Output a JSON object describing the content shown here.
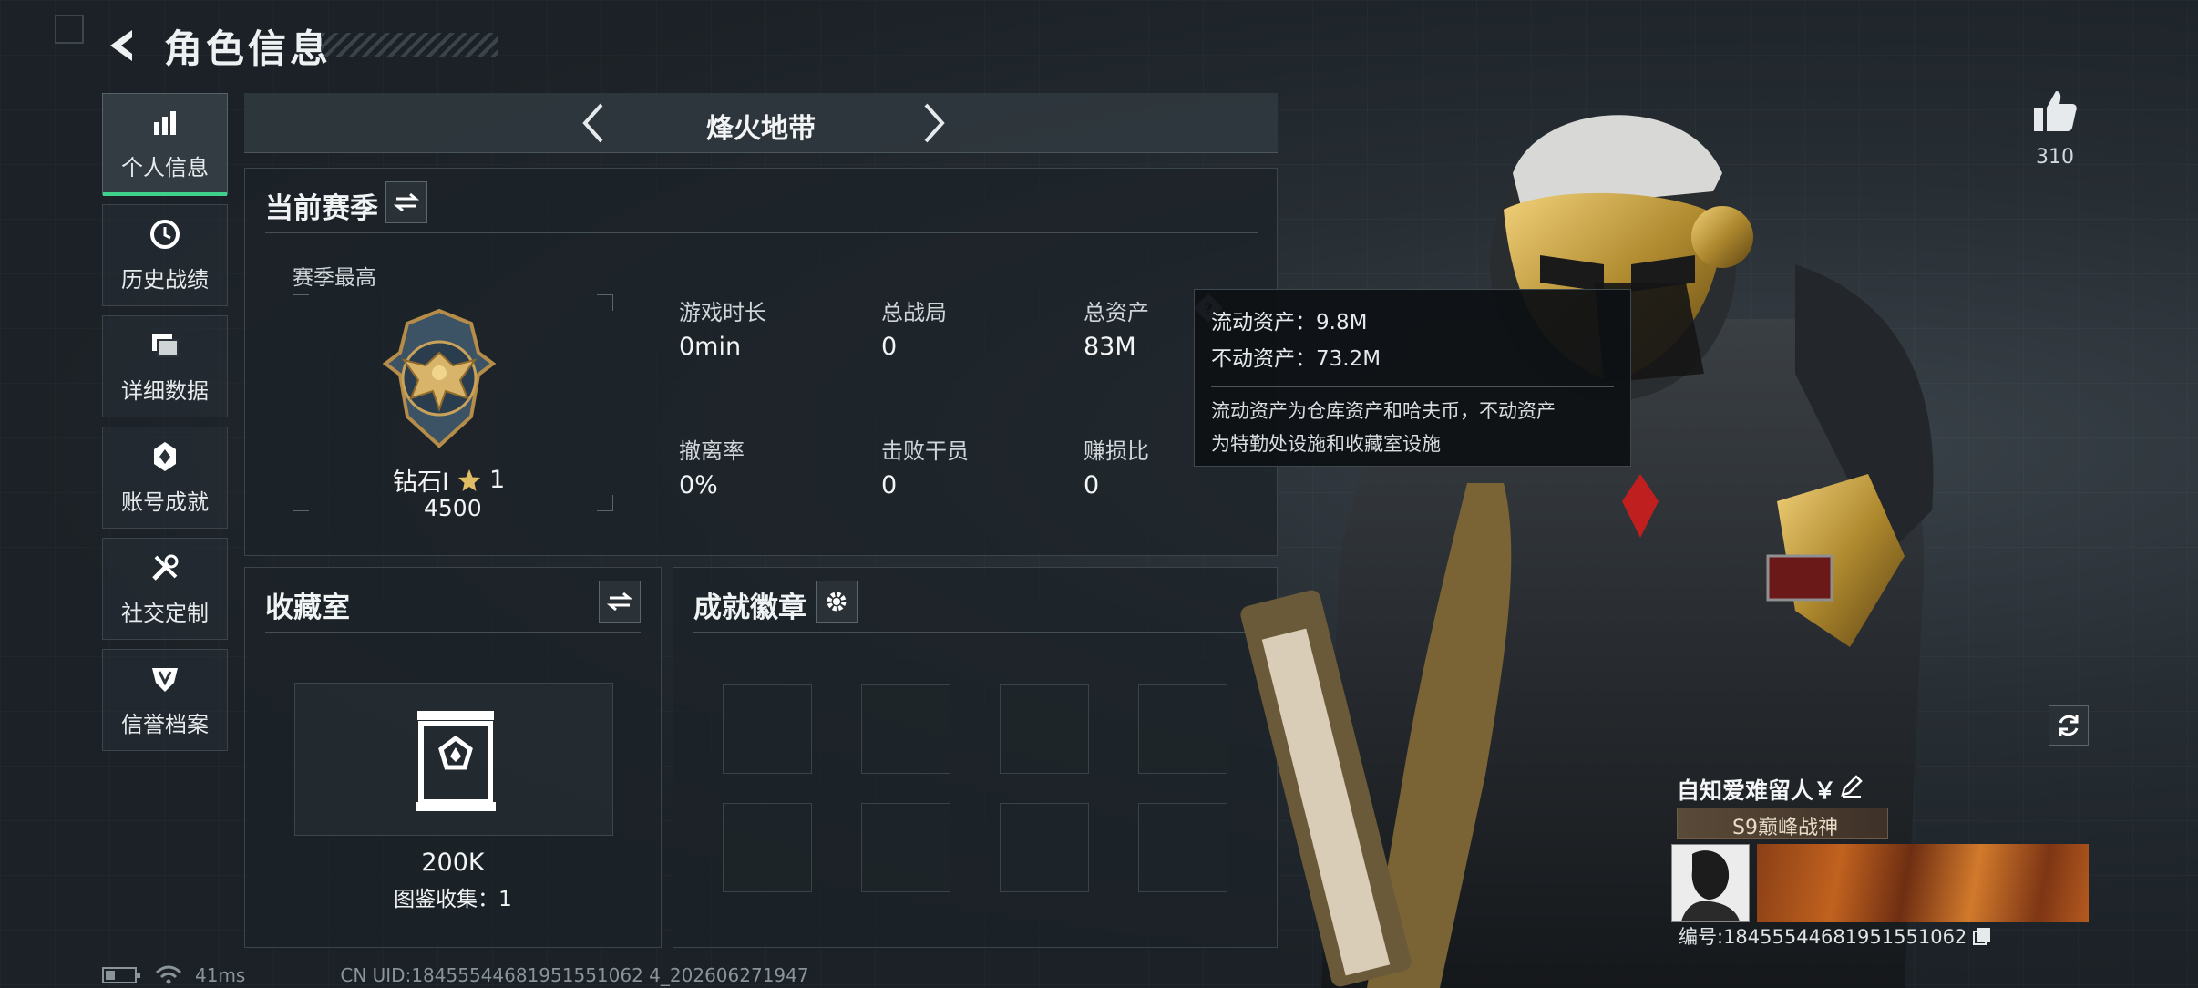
{
  "header": {
    "title": "角色信息"
  },
  "sidebar": {
    "items": [
      {
        "label": "个人信息",
        "icon": "bar-chart-icon",
        "active": true
      },
      {
        "label": "历史战绩",
        "icon": "clock-history-icon",
        "active": false
      },
      {
        "label": "详细数据",
        "icon": "folders-icon",
        "active": false
      },
      {
        "label": "账号成就",
        "icon": "achievement-icon",
        "active": false
      },
      {
        "label": "社交定制",
        "icon": "tools-icon",
        "active": false
      },
      {
        "label": "信誉档案",
        "icon": "shield-emblem-icon",
        "active": false
      }
    ]
  },
  "mode": {
    "title": "烽火地带"
  },
  "season": {
    "title": "当前赛季",
    "best_label": "赛季最高",
    "rank_name": "钻石Ⅰ",
    "rank_stars": "1",
    "rank_points": "4500",
    "stats": [
      {
        "label": "游戏时长",
        "value": "0min"
      },
      {
        "label": "总战局",
        "value": "0"
      },
      {
        "label": "总资产",
        "value": "83M"
      },
      {
        "label": "撤离率",
        "value": "0%"
      },
      {
        "label": "击败干员",
        "value": "0"
      },
      {
        "label": "赚损比",
        "value": "0"
      }
    ]
  },
  "tooltip": {
    "liquid": "流动资产：9.8M",
    "fixed": "不动资产：73.2M",
    "desc_line1": "流动资产为仓库资产和哈夫币，不动资产",
    "desc_line2": "为特勤处设施和收藏室设施"
  },
  "collection": {
    "title": "收藏室",
    "value": "200K",
    "count_text": "图鉴收集：1"
  },
  "badges": {
    "title": "成就徽章"
  },
  "likes": {
    "count": "310"
  },
  "player": {
    "name": "自知爱难留人￥",
    "title_tag": "S9巅峰战神",
    "id_text": "编号:18455544681951551062"
  },
  "status": {
    "ping": "41ms",
    "uid": "CN UID:18455544681951551062 4_202606271947"
  },
  "colors": {
    "accent_green": "#3fd18b",
    "panel_bg": "#1c2328"
  }
}
